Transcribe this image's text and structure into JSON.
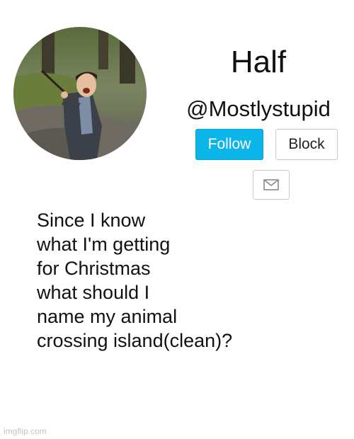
{
  "profile": {
    "avatar_icon": "profile-photo",
    "display_name": "Half",
    "handle": "@Mostlystupid"
  },
  "actions": {
    "follow_label": "Follow",
    "block_label": "Block",
    "message_icon": "envelope-icon"
  },
  "post": {
    "lines": [
      "Since I know",
      "what I'm getting",
      "for Christmas",
      "what should I",
      "name my animal",
      "crossing island(clean)?"
    ]
  },
  "watermark": "imgflip.com",
  "colors": {
    "follow_bg": "#0bb5ea",
    "background": "#ffffff",
    "text": "#111111"
  }
}
